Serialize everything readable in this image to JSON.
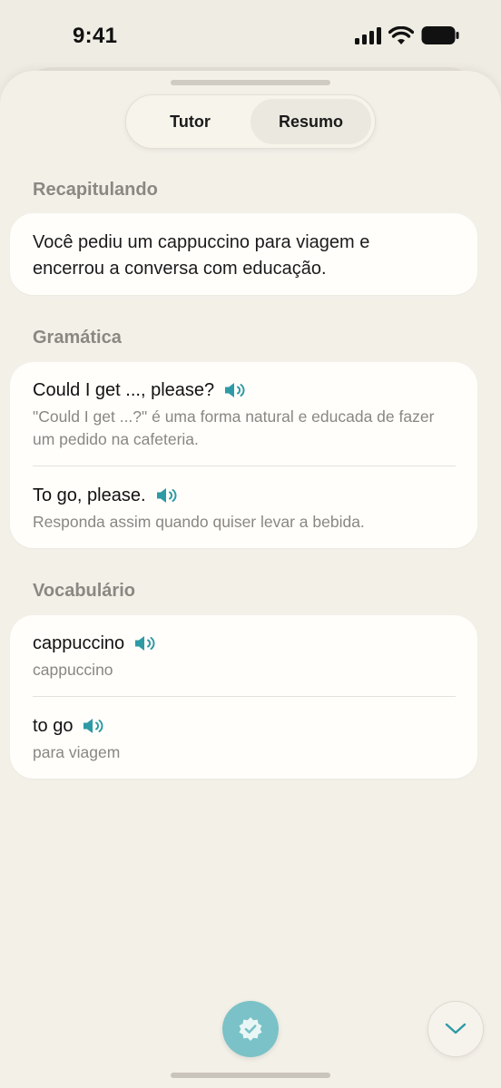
{
  "status": {
    "time": "9:41"
  },
  "tabs": [
    {
      "label": "Tutor",
      "active": false
    },
    {
      "label": "Resumo",
      "active": true
    }
  ],
  "recap": {
    "title": "Recapitulando",
    "text": "Você pediu um cappuccino para viagem e encerrou a conversa com educação."
  },
  "grammar": {
    "title": "Gramática",
    "items": [
      {
        "phrase": "Could I get ..., please?",
        "note": "\"Could I get ...?\" é uma forma natural e educada de fazer um pedido na cafeteria."
      },
      {
        "phrase": "To go, please.",
        "note": "Responda assim quando quiser levar a bebida."
      }
    ]
  },
  "vocab": {
    "title": "Vocabulário",
    "items": [
      {
        "word": "cappuccino",
        "translation": "cappuccino"
      },
      {
        "word": "to go",
        "translation": "para viagem"
      }
    ]
  },
  "icons": {
    "audio": "speaker-icon",
    "check": "check-badge-icon",
    "down": "chevron-down-icon"
  },
  "colors": {
    "accent": "#2e9aa5",
    "check_bg": "#7ac2c7"
  }
}
